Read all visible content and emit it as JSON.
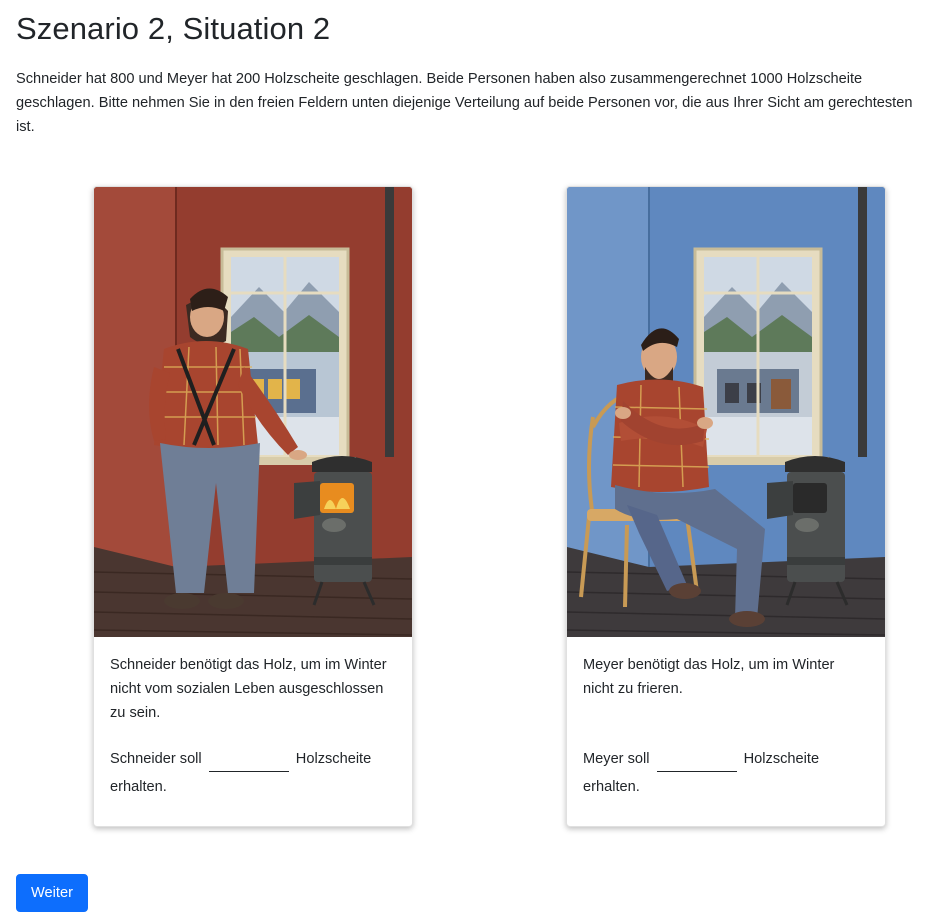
{
  "page": {
    "title": "Szenario 2, Situation 2",
    "intro": "Schneider hat 800 und Meyer hat 200 Holzscheite geschlagen. Beide Personen haben also zusammengerechnet 1000 Holzscheite geschlagen. Bitte nehmen Sie in den freien Feldern unten diejenige Verteilung auf beide Personen vor, die aus Ihrer Sicht am gerechtesten ist."
  },
  "cards": [
    {
      "person": "Schneider",
      "wall_color": "#9a3f30",
      "need_text": "Schneider benötigt das Holz, um im Winter nicht vom sozialen Leben ausgeschlossen zu sein.",
      "alloc_prefix": "Schneider soll",
      "alloc_suffix": "Holzscheite erhalten.",
      "input_value": ""
    },
    {
      "person": "Meyer",
      "wall_color": "#5b86bf",
      "need_text": "Meyer benötigt das Holz, um im Winter nicht zu frieren.",
      "alloc_prefix": "Meyer soll",
      "alloc_suffix": "Holzscheite erhalten.",
      "input_value": ""
    }
  ],
  "actions": {
    "next_label": "Weiter",
    "next_color": "#0d6efd"
  }
}
